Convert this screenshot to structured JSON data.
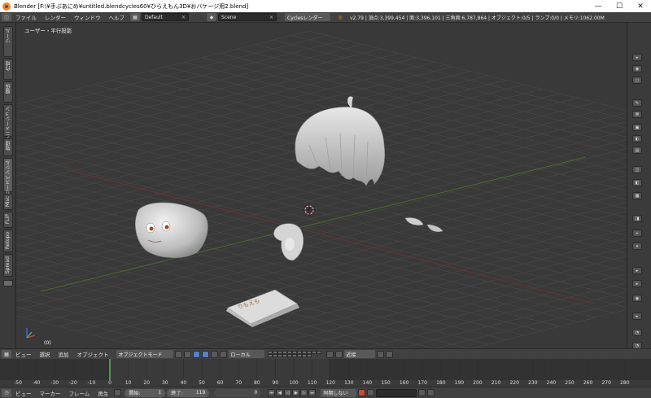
{
  "window": {
    "title": "Blender  [F:\\¥手ぶあにめ¥untitled.blendcycles60¥ひらえもん3D¥おバケージ用2.blend]",
    "minimize": "—",
    "maximize": "☐",
    "close": "✕"
  },
  "info_header": {
    "menus": [
      "ファイル",
      "レンダー",
      "ウィンドウ",
      "ヘルプ"
    ],
    "layout": "Default",
    "scene": "Scene",
    "engine": "Cyclesレンダー",
    "stats": "v2.79 | 頂点:3,399,454 | 面:3,396,101 | 三角面:6,787,864 | オブジェクト:0/5 | ランプ:0/0 | メモリ:1062.00M"
  },
  "toolshelf_tabs": [
    "ツール",
    "作成",
    "関係",
    "アニメーション",
    "物理",
    "グリースペンシル",
    "Misc",
    "FLIP",
    "Retopo",
    "Spread"
  ],
  "viewport": {
    "label": "ユーザー・平行投影",
    "frame": "(0)",
    "box_text": "りもえも"
  },
  "view_header": {
    "menus": [
      "ビュー",
      "選択",
      "追加",
      "オブジェクト"
    ],
    "mode": "オブジェクトモード",
    "orientation": "ローカル",
    "snap": "近接"
  },
  "timeline": {
    "ticks": [
      "-50",
      "-40",
      "-30",
      "-20",
      "-10",
      "0",
      "10",
      "20",
      "30",
      "40",
      "50",
      "60",
      "70",
      "80",
      "90",
      "100",
      "110",
      "120",
      "130",
      "140",
      "150",
      "160",
      "170",
      "180",
      "190",
      "200",
      "210",
      "220",
      "230",
      "240",
      "250",
      "260",
      "270",
      "280"
    ],
    "menus": [
      "ビュー",
      "マーカー",
      "フレーム",
      "再生"
    ],
    "start_label": "開始:",
    "start_value": "1",
    "end_label": "終了:",
    "end_value": "119",
    "current_frame": "0",
    "sync": "同期しない"
  }
}
